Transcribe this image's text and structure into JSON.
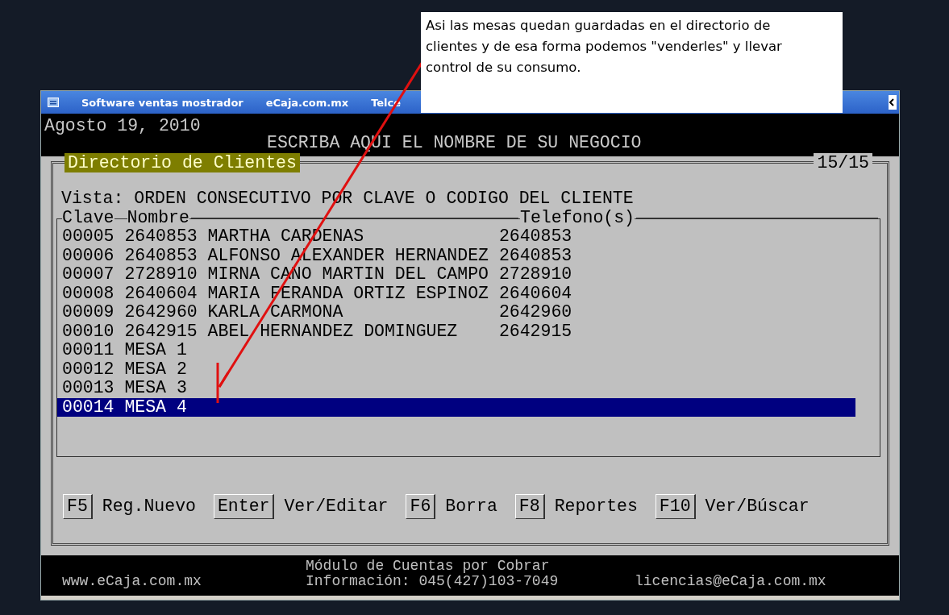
{
  "window": {
    "title_tabs": [
      "Software ventas mostrador",
      "eCaja.com.mx",
      "Telce"
    ]
  },
  "header": {
    "date": "Agosto 19, 2010",
    "business_name": "ESCRIBA AQUI EL NOMBRE DE SU NEGOCIO"
  },
  "panel": {
    "title": "Directorio de Clientes",
    "counter": "15/15",
    "view": "Vista: ORDEN CONSECUTIVO POR CLAVE O CODIGO DEL CLIENTE",
    "columns": [
      "Clave",
      "Nombre",
      "Telefono(s)"
    ],
    "rows": [
      {
        "clave": "00005",
        "nombre": "2640853 MARTHA CARDENAS",
        "telefono": "2640853",
        "selected": false
      },
      {
        "clave": "00006",
        "nombre": "2640853 ALFONSO ALEXANDER HERNANDEZ",
        "telefono": "2640853",
        "selected": false
      },
      {
        "clave": "00007",
        "nombre": "2728910 MIRNA CANO MARTIN DEL CAMPO",
        "telefono": "2728910",
        "selected": false
      },
      {
        "clave": "00008",
        "nombre": "2640604 MARIA FERANDA ORTIZ ESPINOZ",
        "telefono": "2640604",
        "selected": false
      },
      {
        "clave": "00009",
        "nombre": "2642960 KARLA CARMONA",
        "telefono": "2642960",
        "selected": false
      },
      {
        "clave": "00010",
        "nombre": "2642915 ABEL HERNANDEZ DOMINGUEZ",
        "telefono": "2642915",
        "selected": false
      },
      {
        "clave": "00011",
        "nombre": "MESA 1",
        "selected": false
      },
      {
        "clave": "00012",
        "nombre": "MESA 2",
        "selected": false
      },
      {
        "clave": "00013",
        "nombre": "MESA 3",
        "selected": false
      },
      {
        "clave": "00014",
        "nombre": "MESA 4",
        "selected": true
      }
    ],
    "keys": [
      {
        "key": "F5",
        "action": "Reg.Nuevo"
      },
      {
        "key": "Enter",
        "action": "Ver/Editar"
      },
      {
        "key": "F6",
        "action": "Borra"
      },
      {
        "key": "F8",
        "action": "Reportes"
      },
      {
        "key": "F10",
        "action": "Ver/Búscar"
      }
    ]
  },
  "status_bar": {
    "module": "Módulo de Cuentas por Cobrar",
    "website": "www.eCaja.com.mx",
    "info": "Información: 045(427)103-7049",
    "email": "licencias@eCaja.com.mx"
  },
  "callout": {
    "text": "Asi las mesas quedan guardadas en el directorio de clientes y de esa forma podemos \"venderles\" y llevar control de su consumo."
  }
}
